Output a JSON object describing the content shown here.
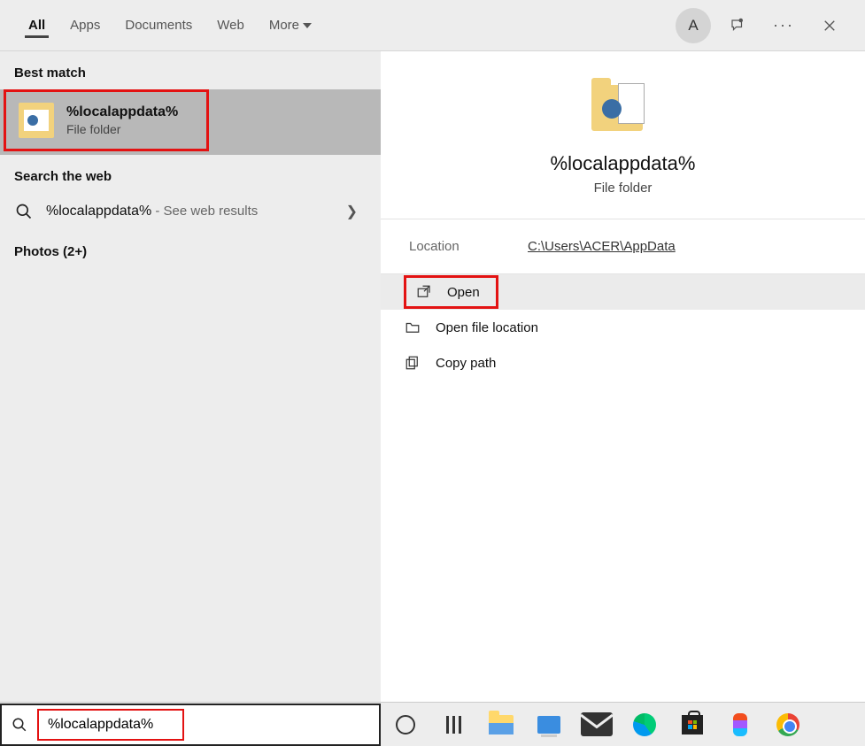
{
  "tabs": {
    "all": "All",
    "apps": "Apps",
    "documents": "Documents",
    "web": "Web",
    "more": "More"
  },
  "avatar_letter": "A",
  "sections": {
    "best_match": "Best match",
    "search_web": "Search the web",
    "photos": "Photos (2+)"
  },
  "best": {
    "title": "%localappdata%",
    "subtitle": "File folder"
  },
  "web": {
    "query": "%localappdata%",
    "suffix": " - See web results"
  },
  "preview": {
    "title": "%localappdata%",
    "subtitle": "File folder",
    "location_label": "Location",
    "location_value": "C:\\Users\\ACER\\AppData"
  },
  "actions": {
    "open": "Open",
    "open_location": "Open file location",
    "copy_path": "Copy path"
  },
  "search_input": "%localappdata%"
}
